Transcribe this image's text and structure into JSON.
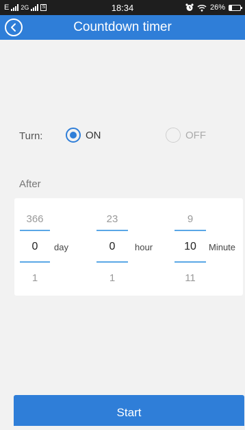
{
  "status_bar": {
    "carrier_left": "E",
    "network_2g": "2G",
    "sim_label": "S",
    "time": "18:34",
    "battery": "26%",
    "battery_level": 0.26
  },
  "header": {
    "title": "Countdown timer"
  },
  "turn": {
    "label": "Turn:",
    "on_label": "ON",
    "off_label": "OFF",
    "selected": "ON"
  },
  "after_label": "After",
  "picker": {
    "day": {
      "prev": "366",
      "current": "0",
      "next": "1",
      "unit": "day"
    },
    "hour": {
      "prev": "23",
      "current": "0",
      "next": "1",
      "unit": "hour"
    },
    "minute": {
      "prev": "9",
      "current": "10",
      "next": "11",
      "unit": "Minute"
    }
  },
  "start_label": "Start",
  "colors": {
    "accent": "#2f7ed8",
    "picker_line": "#5aa7e6",
    "background": "#f2f2f2"
  }
}
